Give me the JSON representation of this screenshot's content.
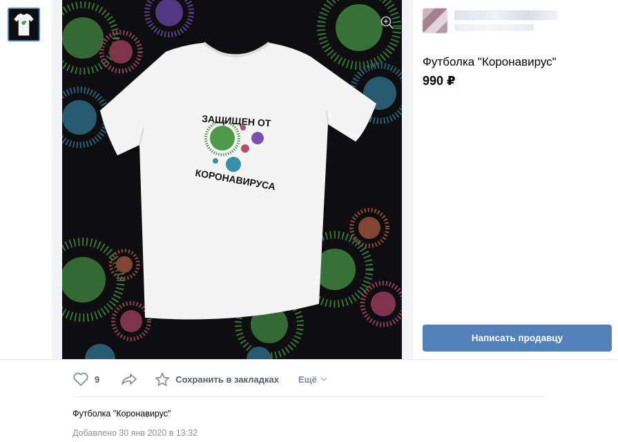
{
  "product": {
    "title": "Футболка \"Коронавирус\"",
    "price": "990 ₽",
    "print_top_text": "ЗАЩИЩЕН ОТ",
    "print_bottom_text": "КОРОНАВИРУСА"
  },
  "seller_button": "Написать продавцу",
  "actions": {
    "like_count": "9",
    "save_label": "Сохранить в закладках",
    "more_label": "Ещё"
  },
  "description": "Футболка \"Коронавирус\"",
  "added_date": "Добавлено 30 янв 2020 в 13:32",
  "colors": {
    "accent": "#5181b8",
    "photo_background": "#0e0e10",
    "virus_green": "#4e9a4a",
    "virus_purple": "#7a4fb0",
    "virus_pink": "#b0506a",
    "virus_teal": "#3a8fa8",
    "virus_orange": "#c0644a"
  },
  "icons": [
    "zoom-icon",
    "heart-icon",
    "share-icon",
    "star-icon",
    "chevron-down-icon"
  ]
}
